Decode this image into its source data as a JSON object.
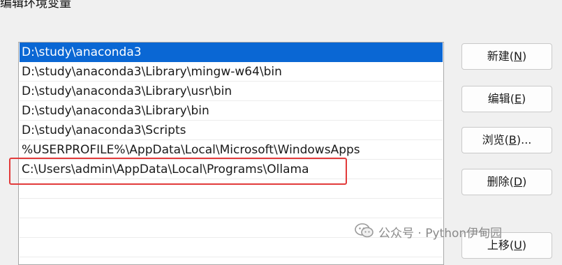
{
  "window": {
    "title": "编辑环境变量"
  },
  "paths": [
    "D:\\study\\anaconda3",
    "D:\\study\\anaconda3\\Library\\mingw-w64\\bin",
    "D:\\study\\anaconda3\\Library\\usr\\bin",
    "D:\\study\\anaconda3\\Library\\bin",
    "D:\\study\\anaconda3\\Scripts",
    "%USERPROFILE%\\AppData\\Local\\Microsoft\\WindowsApps",
    "C:\\Users\\admin\\AppData\\Local\\Programs\\Ollama"
  ],
  "selected_index": 0,
  "highlighted_index": 6,
  "buttons": {
    "new": {
      "label": "新建(",
      "key": "N",
      "suffix": ")"
    },
    "edit": {
      "label": "编辑(",
      "key": "E",
      "suffix": ")"
    },
    "browse": {
      "label": "浏览(",
      "key": "B",
      "suffix": ")..."
    },
    "delete": {
      "label": "删除(",
      "key": "D",
      "suffix": ")"
    },
    "move_up": {
      "label": "上移(",
      "key": "U",
      "suffix": ")"
    }
  },
  "watermark": {
    "text": "公众号 · Python伊甸园",
    "icon": "wechat-icon"
  },
  "colors": {
    "selection": "#0a67d4",
    "highlight_box": "#e23a3a"
  }
}
